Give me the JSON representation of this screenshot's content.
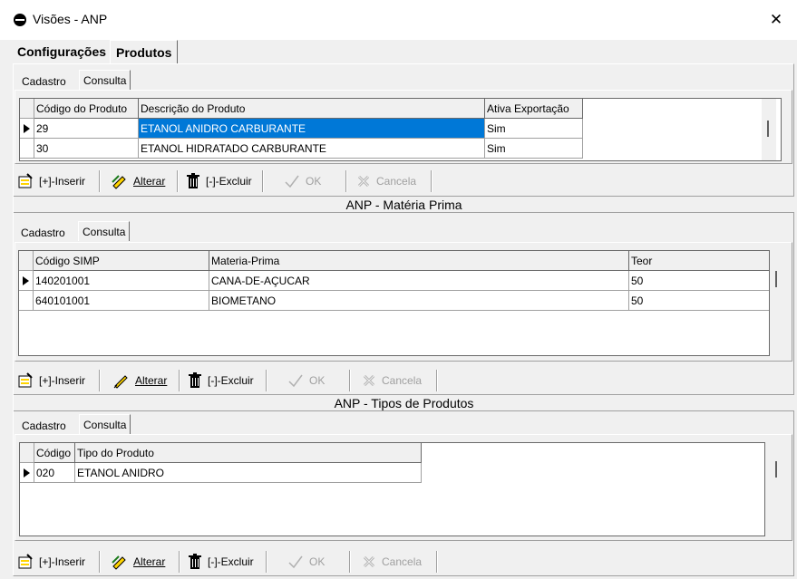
{
  "window": {
    "title": "Visões - ANP",
    "close_glyph": "✕"
  },
  "main_tabs": [
    "Configurações",
    "Produtos"
  ],
  "toolbar": {
    "inserir": "[+]-Inserir",
    "alterar": "Alterar",
    "excluir": "[-]-Excluir",
    "ok": "OK",
    "cancela": "Cancela"
  },
  "produtos": {
    "tabs": [
      "Cadastro",
      "Consulta"
    ],
    "columns": [
      "Código do Produto",
      "Descrição do Produto",
      "Ativa Exportação"
    ],
    "rows": [
      [
        "29",
        "ETANOL ANIDRO CARBURANTE",
        "Sim"
      ],
      [
        "30",
        "ETANOL HIDRATADO CARBURANTE",
        "Sim"
      ]
    ]
  },
  "materia_prima": {
    "title": "ANP - Matéria Prima",
    "tabs": [
      "Cadastro",
      "Consulta"
    ],
    "columns": [
      "Código SIMP",
      "Materia-Prima",
      "Teor"
    ],
    "rows": [
      [
        "140201001",
        "CANA-DE-AÇUCAR",
        "50"
      ],
      [
        "640101001",
        "BIOMETANO",
        "50"
      ]
    ]
  },
  "tipos_produtos": {
    "title": "ANP - Tipos de Produtos",
    "tabs": [
      "Cadastro",
      "Consulta"
    ],
    "columns": [
      "Código",
      "Tipo do Produto"
    ],
    "rows": [
      [
        "020",
        "ETANOL ANIDRO"
      ]
    ]
  },
  "colors": {
    "selection": "#0078d7",
    "background": "#f0f0f0"
  }
}
